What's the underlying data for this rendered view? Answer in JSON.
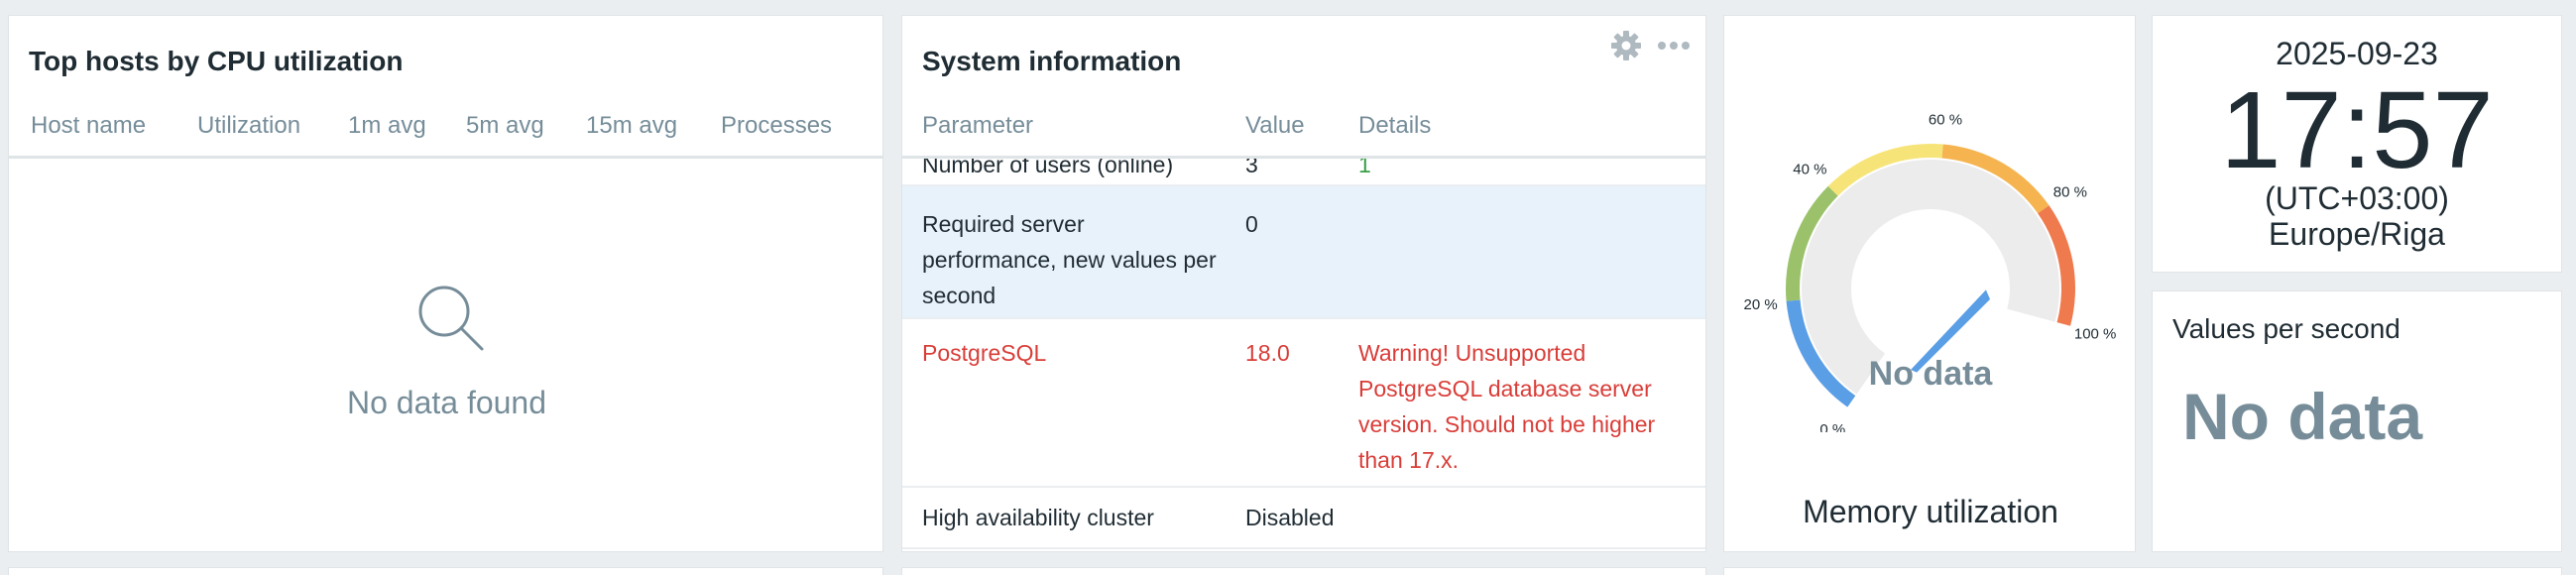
{
  "top_hosts": {
    "title": "Top hosts by CPU utilization",
    "columns": [
      "Host name",
      "Utilization",
      "1m avg",
      "5m avg",
      "15m avg",
      "Processes"
    ],
    "empty_text": "No data found"
  },
  "system_info": {
    "title": "System information",
    "columns": [
      "Parameter",
      "Value",
      "Details"
    ],
    "rows": [
      {
        "parameter": "Number of users (online)",
        "value": "3",
        "details": "1"
      },
      {
        "parameter": "Required server performance, new values per second",
        "value": "0",
        "details": ""
      },
      {
        "parameter": "PostgreSQL",
        "value": "18.0",
        "details": "Warning! Unsupported PostgreSQL database server version. Should not be higher than 17.x."
      },
      {
        "parameter": "High availability cluster",
        "value": "Disabled",
        "details": ""
      }
    ]
  },
  "gauge": {
    "title": "Memory utilization",
    "value_text": "No data",
    "scale_labels": [
      "0 %",
      "20 %",
      "40 %",
      "60 %",
      "80 %",
      "100 %"
    ],
    "colors": [
      "#5a9ee6",
      "#9bc26a",
      "#f7e479",
      "#f5b450",
      "#ef7a4d"
    ]
  },
  "clock": {
    "date": "2025-09-23",
    "time": "17:57",
    "timezone": "(UTC+03:00)",
    "city": "Europe/Riga"
  },
  "values_per_second": {
    "title": "Values per second",
    "value": "No data"
  },
  "colors": {
    "background": "#ebeef0",
    "warning": "#d93d38",
    "highlight_row": "#e8f2fb",
    "muted_text": "#768d99"
  }
}
